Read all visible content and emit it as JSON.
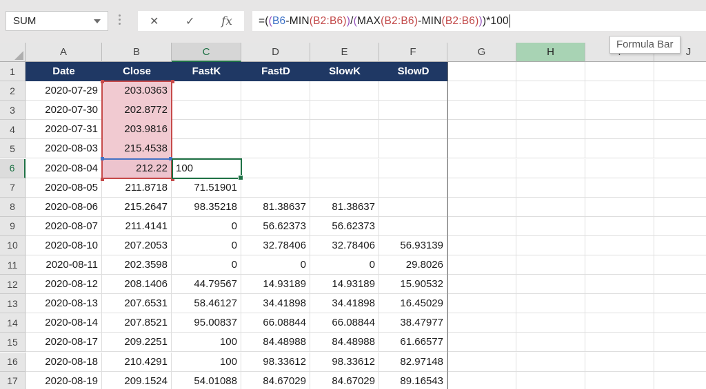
{
  "name_box": {
    "value": "SUM"
  },
  "formula_buttons": {
    "cancel_icon": "✕",
    "enter_icon": "✓",
    "fx_icon": "fx"
  },
  "formula_bar": {
    "tooltip": "Formula Bar",
    "formula_text": "=((B6-MIN(B2:B6))/(MAX(B2:B6)-MIN(B2:B6)))*100",
    "tokens": [
      {
        "t": "=(",
        "c": "k"
      },
      {
        "t": "(",
        "c": "p"
      },
      {
        "t": "B6",
        "c": "b"
      },
      {
        "t": "-MIN",
        "c": "k"
      },
      {
        "t": "(B2:B6)",
        "c": "r"
      },
      {
        "t": ")",
        "c": "p"
      },
      {
        "t": "/",
        "c": "k"
      },
      {
        "t": "(",
        "c": "p"
      },
      {
        "t": "MAX",
        "c": "k"
      },
      {
        "t": "(B2:B6)",
        "c": "r"
      },
      {
        "t": "-MIN",
        "c": "k"
      },
      {
        "t": "(B2:B6)",
        "c": "r"
      },
      {
        "t": ")",
        "c": "p"
      },
      {
        "t": ")",
        "c": "k"
      },
      {
        "t": "*100",
        "c": "k"
      }
    ]
  },
  "colors": {
    "token_k": "#202020",
    "token_b": "#3A6FC5",
    "token_r": "#C24848",
    "token_p": "#9651BC",
    "header_fill": "#1F3864",
    "range_fill": "#F1CAD1",
    "cell_b6_fill": "#EDC4CE",
    "range_border": "#C64A4A",
    "ref_border": "#4472C4",
    "edit_border": "#1E7145",
    "hover_fill": "#A8D3B4"
  },
  "sheet": {
    "column_letters": [
      "A",
      "B",
      "C",
      "D",
      "E",
      "F",
      "G",
      "H",
      "I",
      "J"
    ],
    "selected_column": "C",
    "hovered_column": "H",
    "selected_row": 6,
    "header_row": {
      "row": 1,
      "labels": [
        "Date",
        "Close",
        "FastK",
        "FastD",
        "SlowK",
        "SlowD"
      ]
    },
    "highlight_range": {
      "ref": "B2:B6"
    },
    "highlight_cell": {
      "ref": "B6"
    },
    "edit_cell": {
      "ref": "C6",
      "value": "100"
    },
    "rows": [
      {
        "n": 2,
        "cells": [
          "2020-07-29",
          "203.0363",
          "",
          "",
          "",
          ""
        ]
      },
      {
        "n": 3,
        "cells": [
          "2020-07-30",
          "202.8772",
          "",
          "",
          "",
          ""
        ]
      },
      {
        "n": 4,
        "cells": [
          "2020-07-31",
          "203.9816",
          "",
          "",
          "",
          ""
        ]
      },
      {
        "n": 5,
        "cells": [
          "2020-08-03",
          "215.4538",
          "",
          "",
          "",
          ""
        ]
      },
      {
        "n": 6,
        "cells": [
          "2020-08-04",
          "212.22",
          "",
          "",
          "",
          ""
        ]
      },
      {
        "n": 7,
        "cells": [
          "2020-08-05",
          "211.8718",
          "71.51901",
          "",
          "",
          ""
        ]
      },
      {
        "n": 8,
        "cells": [
          "2020-08-06",
          "215.2647",
          "98.35218",
          "81.38637",
          "81.38637",
          ""
        ]
      },
      {
        "n": 9,
        "cells": [
          "2020-08-07",
          "211.4141",
          "0",
          "56.62373",
          "56.62373",
          ""
        ]
      },
      {
        "n": 10,
        "cells": [
          "2020-08-10",
          "207.2053",
          "0",
          "32.78406",
          "32.78406",
          "56.93139"
        ]
      },
      {
        "n": 11,
        "cells": [
          "2020-08-11",
          "202.3598",
          "0",
          "0",
          "0",
          "29.8026"
        ]
      },
      {
        "n": 12,
        "cells": [
          "2020-08-12",
          "208.1406",
          "44.79567",
          "14.93189",
          "14.93189",
          "15.90532"
        ]
      },
      {
        "n": 13,
        "cells": [
          "2020-08-13",
          "207.6531",
          "58.46127",
          "34.41898",
          "34.41898",
          "16.45029"
        ]
      },
      {
        "n": 14,
        "cells": [
          "2020-08-14",
          "207.8521",
          "95.00837",
          "66.08844",
          "66.08844",
          "38.47977"
        ]
      },
      {
        "n": 15,
        "cells": [
          "2020-08-17",
          "209.2251",
          "100",
          "84.48988",
          "84.48988",
          "61.66577"
        ]
      },
      {
        "n": 16,
        "cells": [
          "2020-08-18",
          "210.4291",
          "100",
          "98.33612",
          "98.33612",
          "82.97148"
        ]
      },
      {
        "n": 17,
        "cells": [
          "2020-08-19",
          "209.1524",
          "54.01088",
          "84.67029",
          "84.67029",
          "89.16543"
        ]
      }
    ]
  }
}
